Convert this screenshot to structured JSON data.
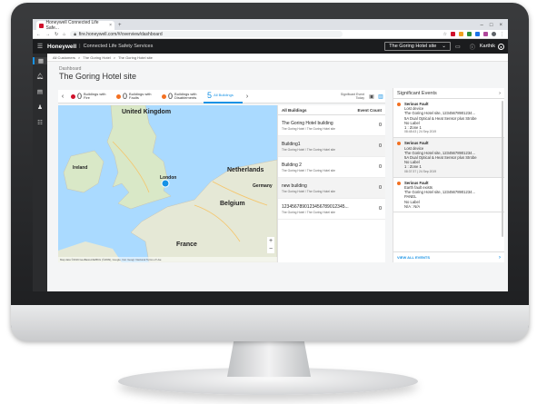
{
  "browser": {
    "tab_title": "Honeywell Connected Life Safe...",
    "tab_close": "×",
    "new_tab": "+",
    "url": "fire.honeywell.com/#/overview/dashboard",
    "window_controls": [
      "–",
      "□",
      "×"
    ]
  },
  "header": {
    "brand": "Honeywell",
    "product": "Connected Life Safety Services",
    "site_select": "The Goring Hotel site",
    "user": "Karthik"
  },
  "breadcrumb": [
    "All Customers",
    ">",
    "The Goring Hotel",
    ">",
    "The Goring Hotel site"
  ],
  "page": {
    "label": "Dashboard",
    "title": "The Goring Hotel site"
  },
  "stats": [
    {
      "value": "0",
      "label": "Buildings with Fire",
      "color": "#d0112b"
    },
    {
      "value": "0",
      "label": "Buildings with Faults",
      "color": "#f37021"
    },
    {
      "value": "0",
      "label": "Buildings with Disablements",
      "color": "#f37021"
    },
    {
      "value": "5",
      "label": "All Buildings",
      "color": "#1792e5"
    }
  ],
  "significant_event_filter": {
    "label": "Significant Event",
    "value": "Today"
  },
  "map": {
    "labels": [
      "United Kingdom",
      "Ireland",
      "Netherlands",
      "London",
      "Belgium",
      "France",
      "Germany"
    ],
    "zoom_in": "+",
    "zoom_out": "−",
    "footer": "Map data ©2019 GeoBasis-DE/BKG (©2009), Google, Inst. Geogr. Nacional   Terms of Use"
  },
  "buildings": {
    "header_name": "All Buildings",
    "header_count": "Event Count",
    "rows": [
      {
        "name": "The Goring Hotel building",
        "sub": "The Goring Hotel / The Goring Hotel site",
        "count": "0"
      },
      {
        "name": "Building1",
        "sub": "The Goring Hotel / The Goring Hotel site",
        "count": "0"
      },
      {
        "name": "Building 2",
        "sub": "The Goring Hotel / The Goring Hotel site",
        "count": "0"
      },
      {
        "name": "new building",
        "sub": "The Goring Hotel / The Goring Hotel site",
        "count": "0"
      },
      {
        "name": "1234567890123456789012345...",
        "sub": "The Goring Hotel / The Goring Hotel site",
        "count": "0"
      }
    ]
  },
  "events": {
    "title": "Significant Events",
    "items": [
      {
        "title": "Serious Fault",
        "lines": [
          "Lost device",
          "The Goring Hotel site, 12345678901234...",
          "5A Dual Optical & Heat Sensor plus Strobe",
          "No Label",
          "1 : Zone 1"
        ],
        "time": "08:48:43 | 24 Sep 2019"
      },
      {
        "title": "Serious Fault",
        "lines": [
          "Lost device",
          "The Goring Hotel site, 12345678901234...",
          "5A Dual Optical & Heat Sensor plus Strobe",
          "No Label",
          "1 : Zone 1"
        ],
        "time": "08:37:37 | 24 Sep 2019"
      },
      {
        "title": "Serious Fault",
        "lines": [
          "Earth fault exists",
          "The Goring Hotel site, 12345678901234...",
          "PANEL",
          "No Label",
          "N/A : N/A"
        ],
        "time": ""
      }
    ],
    "view_all": "VIEW ALL EVENTS"
  },
  "colors": {
    "accent": "#1792e5",
    "fault": "#f37021",
    "fire": "#d0112b",
    "header": "#1b1c1e"
  }
}
